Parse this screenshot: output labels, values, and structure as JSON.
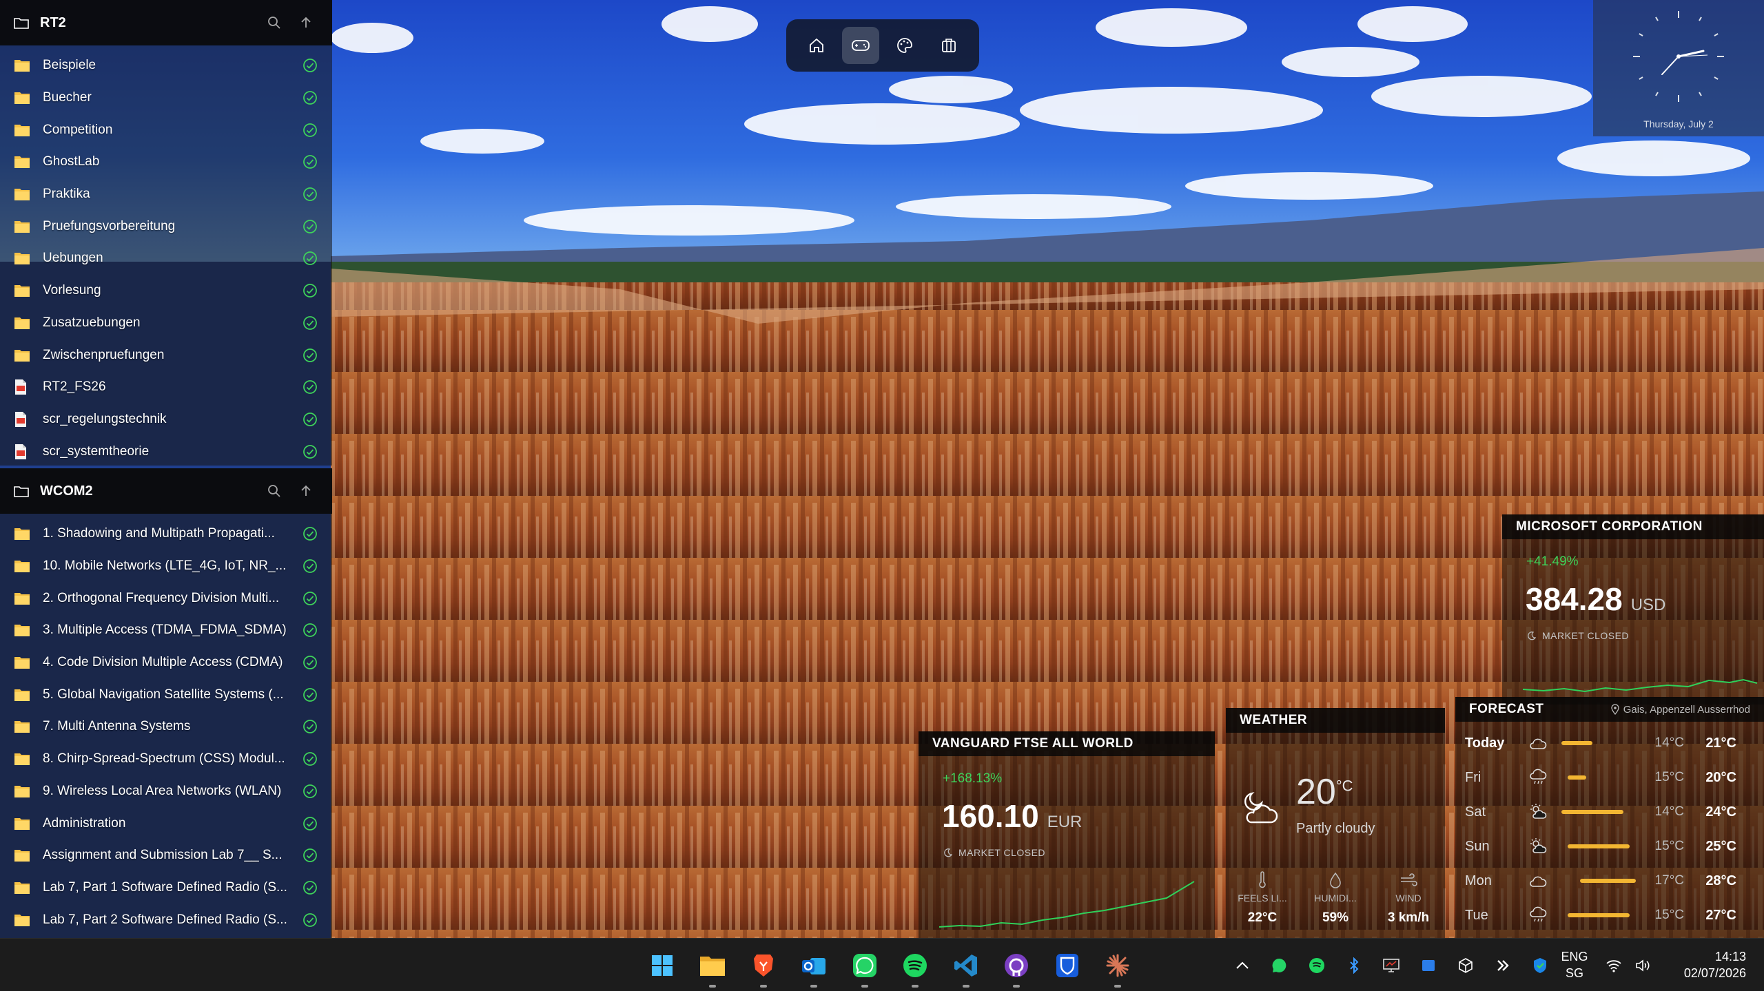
{
  "colors": {
    "accent_green": "#3ed35a",
    "forecast_bar": "#f3b632",
    "sparkline": "#2fd05a"
  },
  "rt2_panel": {
    "title": "RT2",
    "items": [
      {
        "label": "Beispiele",
        "type": "folder"
      },
      {
        "label": "Buecher",
        "type": "folder"
      },
      {
        "label": "Competition",
        "type": "folder"
      },
      {
        "label": "GhostLab",
        "type": "folder"
      },
      {
        "label": "Praktika",
        "type": "folder"
      },
      {
        "label": "Pruefungsvorbereitung",
        "type": "folder"
      },
      {
        "label": "Uebungen",
        "type": "folder"
      },
      {
        "label": "Vorlesung",
        "type": "folder"
      },
      {
        "label": "Zusatzuebungen",
        "type": "folder"
      },
      {
        "label": "Zwischenpruefungen",
        "type": "folder"
      },
      {
        "label": "RT2_FS26",
        "type": "pdf"
      },
      {
        "label": "scr_regelungstechnik",
        "type": "pdf"
      },
      {
        "label": "scr_systemtheorie",
        "type": "pdf"
      }
    ]
  },
  "wcom2_panel": {
    "title": "WCOM2",
    "items": [
      {
        "label": "1. Shadowing and Multipath Propagati...",
        "type": "folder"
      },
      {
        "label": "10. Mobile Networks (LTE_4G, IoT, NR_...",
        "type": "folder"
      },
      {
        "label": "2. Orthogonal Frequency Division Multi...",
        "type": "folder"
      },
      {
        "label": "3. Multiple Access (TDMA_FDMA_SDMA)",
        "type": "folder"
      },
      {
        "label": "4. Code Division Multiple Access (CDMA)",
        "type": "folder"
      },
      {
        "label": "5. Global Navigation Satellite Systems (...",
        "type": "folder"
      },
      {
        "label": "7. Multi Antenna Systems",
        "type": "folder"
      },
      {
        "label": "8. Chirp-Spread-Spectrum (CSS) Modul...",
        "type": "folder"
      },
      {
        "label": "9. Wireless Local Area Networks (WLAN)",
        "type": "folder"
      },
      {
        "label": "Administration",
        "type": "folder"
      },
      {
        "label": "Assignment and Submission Lab 7__ S...",
        "type": "folder"
      },
      {
        "label": "Lab 7, Part 1 Software Defined Radio (S...",
        "type": "folder"
      },
      {
        "label": "Lab 7, Part 2 Software Defined Radio (S...",
        "type": "folder"
      }
    ]
  },
  "topnav": {
    "icons": [
      "home-icon",
      "gamepad-icon",
      "palette-icon",
      "briefcase-icon"
    ],
    "active_index": 1
  },
  "clock": {
    "date": "Thursday, July 2"
  },
  "msft": {
    "title": "MICROSOFT CORPORATION",
    "change": "+41.49%",
    "price": "384.28",
    "currency": "USD",
    "status": "MARKET CLOSED"
  },
  "vanguard": {
    "title": "VANGUARD FTSE ALL WORLD",
    "change": "+168.13%",
    "price": "160.10",
    "currency": "EUR",
    "status": "MARKET CLOSED"
  },
  "weather": {
    "title": "WEATHER",
    "temp": "20",
    "unit": "°C",
    "condition": "Partly cloudy",
    "stats": [
      {
        "label": "FEELS LI...",
        "value": "22°C",
        "icon": "thermometer-icon"
      },
      {
        "label": "HUMIDI...",
        "value": "59%",
        "icon": "droplet-icon"
      },
      {
        "label": "WIND",
        "value": "3 km/h",
        "icon": "wind-icon"
      }
    ]
  },
  "forecast": {
    "title": "FORECAST",
    "location": "Gais, Appenzell Ausserrhod",
    "days": [
      {
        "day": "Today",
        "low": "14°C",
        "high": "21°C",
        "icon": "cloud-icon",
        "bar": [
          0.0,
          0.42
        ]
      },
      {
        "day": "Fri",
        "low": "15°C",
        "high": "20°C",
        "icon": "rain-icon",
        "bar": [
          0.08,
          0.33
        ]
      },
      {
        "day": "Sat",
        "low": "14°C",
        "high": "24°C",
        "icon": "partly-sunny-icon",
        "bar": [
          0.0,
          0.83
        ]
      },
      {
        "day": "Sun",
        "low": "15°C",
        "high": "25°C",
        "icon": "partly-sunny-icon",
        "bar": [
          0.08,
          0.92
        ]
      },
      {
        "day": "Mon",
        "low": "17°C",
        "high": "28°C",
        "icon": "cloud-icon",
        "bar": [
          0.25,
          1.0
        ]
      },
      {
        "day": "Tue",
        "low": "15°C",
        "high": "27°C",
        "icon": "rain-icon",
        "bar": [
          0.08,
          0.92
        ]
      }
    ]
  },
  "taskbar": {
    "apps": [
      "windows-start-icon",
      "file-explorer-icon",
      "brave-icon",
      "outlook-icon",
      "whatsapp-icon",
      "spotify-icon",
      "vscode-icon",
      "github-desktop-icon",
      "bitwarden-icon",
      "claude-icon"
    ],
    "running": [
      false,
      true,
      true,
      true,
      true,
      true,
      true,
      true,
      false,
      true
    ],
    "tray": [
      "chevron-up-icon",
      "whatsapp-tray-icon",
      "spotify-tray-icon",
      "bluetooth-icon",
      "display-icon",
      "onedrive-icon",
      "cube-icon",
      "claude-tray-icon",
      "defender-icon"
    ],
    "language": "ENG",
    "region": "SG",
    "time": "14:13",
    "date": "02/07/2026"
  }
}
